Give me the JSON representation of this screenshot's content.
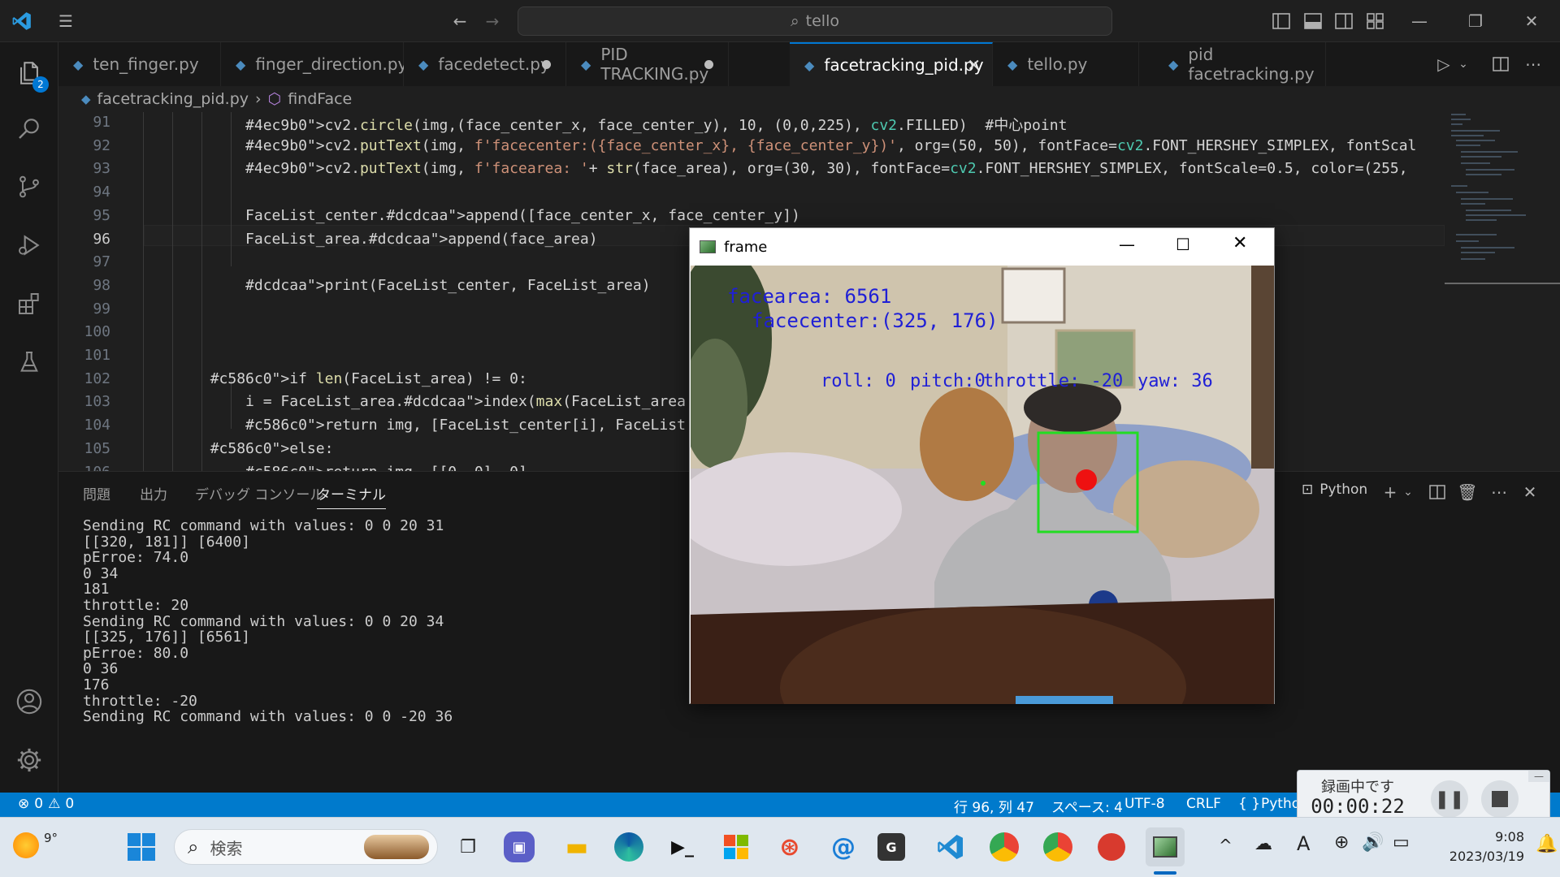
{
  "titlebar": {
    "search_text": "tello",
    "icons": [
      "vscode-logo",
      "menu-icon",
      "back-arrow-icon",
      "forward-arrow-icon",
      "search-icon",
      "toggle-primary-sidebar-icon",
      "toggle-panel-icon",
      "toggle-secondary-sidebar-icon",
      "customize-layout-icon",
      "minimize-icon",
      "restore-icon",
      "close-icon"
    ]
  },
  "activitybar": {
    "explorer_badge": "2",
    "icons": [
      "explorer-icon",
      "search-icon",
      "source-control-icon",
      "run-debug-icon",
      "extensions-icon",
      "testing-icon",
      "account-icon",
      "settings-gear-icon"
    ]
  },
  "tabs": [
    {
      "label": "ten_finger.py",
      "dirty": false,
      "active": false
    },
    {
      "label": "finger_direction.py",
      "dirty": false,
      "active": false
    },
    {
      "label": "facedetect.py",
      "dirty": true,
      "active": false
    },
    {
      "label": "PID TRACKING.py",
      "dirty": true,
      "active": false
    },
    {
      "label": "facetracking_pid.py",
      "dirty": false,
      "active": true
    },
    {
      "label": "tello.py",
      "dirty": false,
      "active": false
    },
    {
      "label": "pid facetracking.py",
      "dirty": false,
      "active": false
    }
  ],
  "breadcrumb": {
    "file": "facetracking_pid.py",
    "symbol": "findFace"
  },
  "editor": {
    "current_line": "96",
    "lines": [
      {
        "n": "91",
        "code": "            cv2.circle(img,(face_center_x, face_center_y), 10, (0,0,225), cv2.FILLED)  #中心point"
      },
      {
        "n": "92",
        "code": "            cv2.putText(img, f'facecenter:({face_center_x}, {face_center_y})', org=(50, 50), fontFace=cv2.FONT_HERSHEY_SIMPLEX, fontScal"
      },
      {
        "n": "93",
        "code": "            cv2.putText(img, f'facearea: '+ str(face_area), org=(30, 30), fontFace=cv2.FONT_HERSHEY_SIMPLEX, fontScale=0.5, color=(255,"
      },
      {
        "n": "94",
        "code": ""
      },
      {
        "n": "95",
        "code": "            FaceList_center.append([face_center_x, face_center_y])"
      },
      {
        "n": "96",
        "code": "            FaceList_area.append(face_area)"
      },
      {
        "n": "97",
        "code": ""
      },
      {
        "n": "98",
        "code": "            print(FaceList_center, FaceList_area)"
      },
      {
        "n": "99",
        "code": ""
      },
      {
        "n": "100",
        "code": ""
      },
      {
        "n": "101",
        "code": ""
      },
      {
        "n": "102",
        "code": "        if len(FaceList_area) != 0:"
      },
      {
        "n": "103",
        "code": "            i = FaceList_area.index(max(FaceList_area"
      },
      {
        "n": "104",
        "code": "            return img, [FaceList_center[i], FaceList"
      },
      {
        "n": "105",
        "code": "        else:"
      },
      {
        "n": "106",
        "code": "            return img, [[0, 0], 0]"
      }
    ]
  },
  "panel": {
    "tabs": [
      "問題",
      "出力",
      "デバッグ コンソール",
      "ターミナル"
    ],
    "active_tab": "ターミナル",
    "terminal_profile": "Python",
    "terminal_lines": [
      "Sending RC command with values: 0 0 20 31",
      "[[320, 181]] [6400]",
      "pErroe: 74.0",
      "0 34",
      "181",
      "throttle: 20",
      "Sending RC command with values: 0 0 20 34",
      "[[325, 176]] [6561]",
      "pErroe: 80.0",
      "0 36",
      "176",
      "throttle: -20",
      "Sending RC command with values: 0 0 -20 36"
    ]
  },
  "statusbar": {
    "errors": "0",
    "warnings": "0",
    "position": "行 96, 列 47",
    "spaces": "スペース: 4",
    "encoding": "UTF-8",
    "eol": "CRLF",
    "language": "Pytho"
  },
  "frame_window": {
    "title": "frame",
    "overlay": {
      "facearea": "facearea: 6561",
      "facecenter": "facecenter:(325, 176)",
      "roll": "roll: 0",
      "pitch": "pitch:0",
      "throttle": "throttle: -20",
      "yaw": "yaw: 36"
    },
    "colors": {
      "overlay_text": "#1f1fd6",
      "face_box": "#22dd22",
      "center_dot": "#ee1111"
    }
  },
  "recorder": {
    "status": "録画中です",
    "time": "00:00:22"
  },
  "taskbar": {
    "weather_temp": "9°",
    "search_placeholder": "検索",
    "time": "9:08",
    "date": "2023/03/19",
    "ime": "A"
  }
}
